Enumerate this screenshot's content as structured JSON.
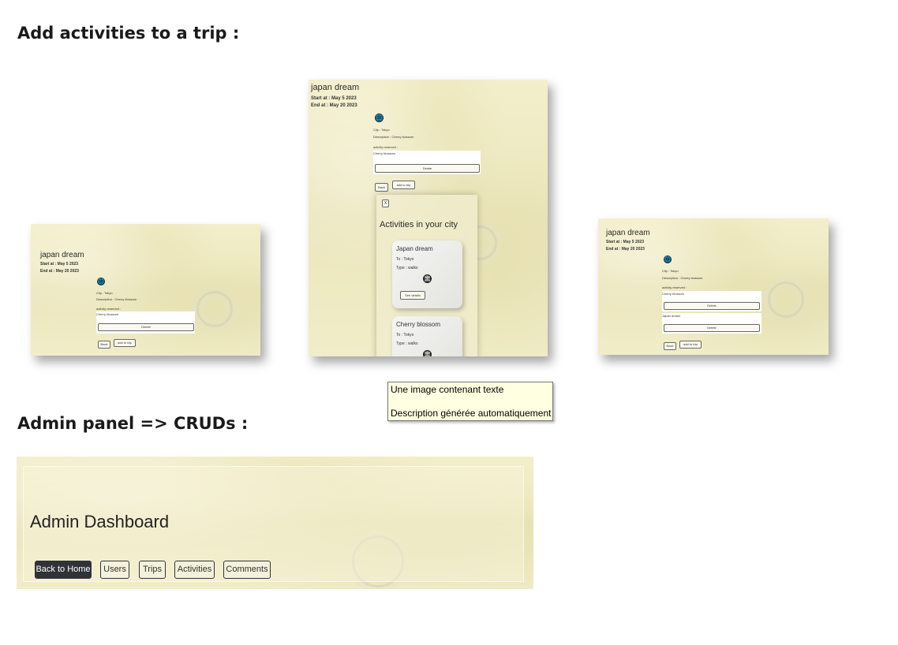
{
  "section1": {
    "heading": "Add activities to a trip :"
  },
  "section2": {
    "heading": "Admin panel => CRUDs :"
  },
  "screens": {
    "left": {
      "trip_name": "japan dream",
      "start": "Start at : May 5 2023",
      "end": "End at : May 20 2023",
      "city": "City : Tokyo",
      "description": "Description : Cherry blossom",
      "reserved_label": "activity reserved :",
      "reserved_item": "Cherry blossom",
      "delete": "Delete",
      "back": "Back",
      "add_to_trip": "add to trip"
    },
    "middle": {
      "trip_name": "japan dream",
      "start": "Start at : May 5 2023",
      "end": "End at : May 20 2023",
      "city": "City : Tokyo",
      "description": "Description : Cherry blossom",
      "reserved_label": "activity reserved :",
      "reserved_item": "Cherry blossom",
      "delete": "Delete",
      "back": "Back",
      "add_to_trip": "add to trip",
      "modal_close": "X",
      "modal_title": "Activities in your city",
      "cards": [
        {
          "title": "Japan dream",
          "to": "To : Tokyo",
          "type": "Type : walks",
          "see_details": "See details"
        },
        {
          "title": "Cherry blossom",
          "to": "To : Tokyo",
          "type": "Type : walks"
        }
      ]
    },
    "right": {
      "trip_name": "japan dream",
      "start": "Start at : May 5 2023",
      "end": "End at : May 20 2023",
      "city": "City : Tokyo",
      "description": "Description : Cherry blossom",
      "reserved_label": "activity reserved :",
      "reserved_item_1": "Cherry blossom",
      "reserved_item_2": "Japan dream",
      "delete": "Delete",
      "back": "Back",
      "add_to_trip": "add to trip"
    }
  },
  "tooltip": {
    "line1": "Une image contenant texte",
    "line2": "Description générée automatiquement"
  },
  "admin": {
    "title": "Admin Dashboard",
    "buttons": {
      "back_home": "Back to Home",
      "users": "Users",
      "trips": "Trips",
      "activities": "Activities",
      "comments": "Comments"
    }
  },
  "icons": {
    "globe": "globe-icon",
    "monument": "monument-icon"
  },
  "colors": {
    "paper": "#efeac2",
    "dark_button": "#2f3338",
    "tooltip_bg": "#ffffe1"
  }
}
